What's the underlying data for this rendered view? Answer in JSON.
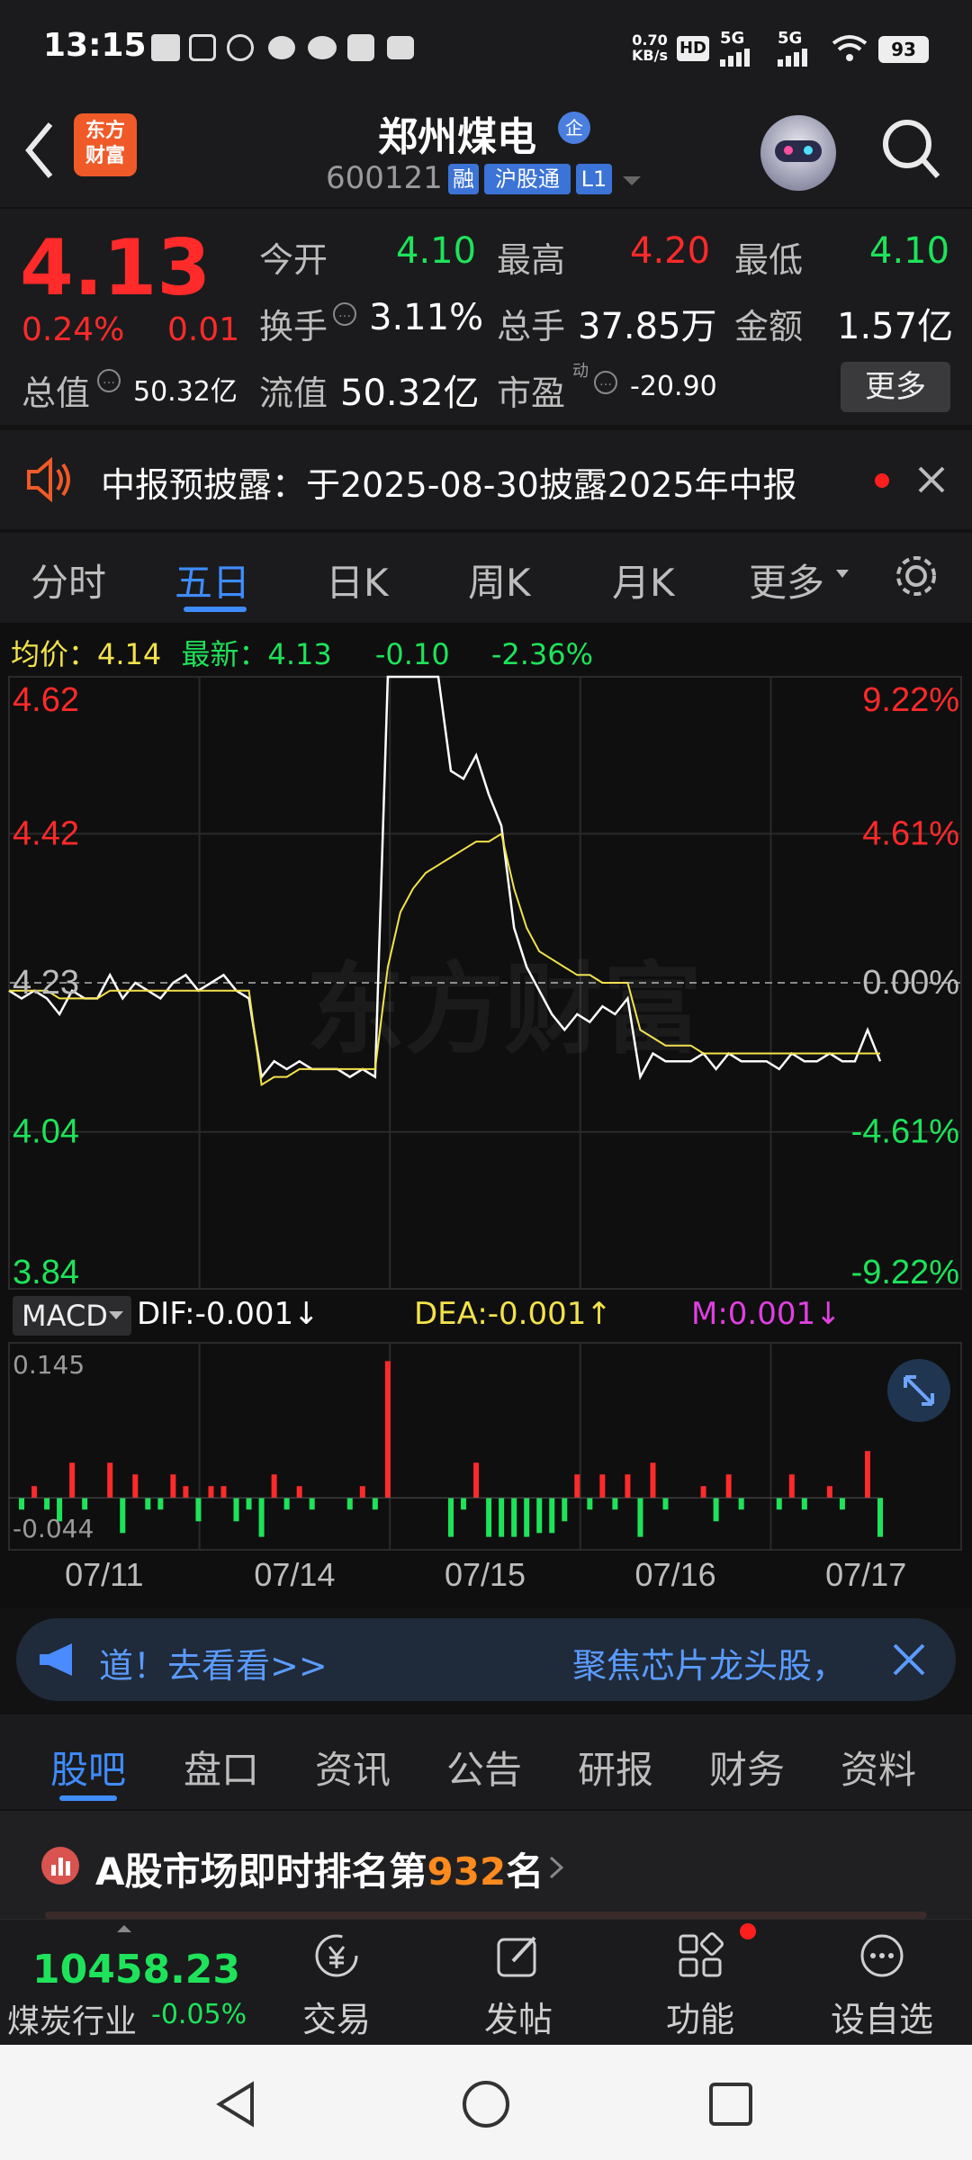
{
  "status_bar": {
    "time": "13:15",
    "net_speed_top": "0.70",
    "net_speed_bottom": "KB/s",
    "hd": "HD",
    "sig1": "5G",
    "sig2": "5G",
    "battery": "93"
  },
  "header": {
    "logo_line1": "东方",
    "logo_line2": "财富",
    "title": "郑州煤电",
    "title_badge": "企",
    "code": "600121",
    "tag_rong": "融",
    "tag_hgt": "沪股通",
    "tag_l1": "L1"
  },
  "quote": {
    "price": "4.13",
    "change_pct": "0.24%",
    "change_amt": "0.01",
    "open_label": "今开",
    "open": "4.10",
    "high_label": "最高",
    "high": "4.20",
    "low_label": "最低",
    "low": "4.10",
    "turnover_label": "换手",
    "turnover": "3.11%",
    "volume_label": "总手",
    "volume": "37.85万",
    "amount_label": "金额",
    "amount": "1.57亿",
    "mktcap_label": "总值",
    "mktcap": "50.32亿",
    "float_label": "流值",
    "float_cap": "50.32亿",
    "pe_label": "市盈",
    "pe_sup": "动",
    "pe": "-20.90",
    "more_button": "更多"
  },
  "notice": {
    "text": "中报预披露：于2025-08-30披露2025年中报"
  },
  "chart_tabs": [
    "分时",
    "五日",
    "日K",
    "周K",
    "月K",
    "更多"
  ],
  "active_chart_tab": "五日",
  "chart_header": {
    "avg_label": "均价：",
    "avg_value": "4.14",
    "latest_label": "最新：",
    "latest_value": "4.13",
    "chg": "-0.10",
    "chg_pct": "-2.36%"
  },
  "watermark": "东方财富",
  "macd": {
    "label": "MACD",
    "dif": "DIF:-0.001↓",
    "dea": "DEA:-0.001↑",
    "m": "M:0.001↓",
    "max": "0.145",
    "min": "-0.044"
  },
  "chart_data": {
    "type": "line",
    "y_left_ticks": [
      "4.62",
      "4.42",
      "4.23",
      "4.04",
      "3.84"
    ],
    "y_right_ticks": [
      "9.22%",
      "4.61%",
      "0.00%",
      "-4.61%",
      "-9.22%"
    ],
    "ylim": [
      3.84,
      4.62
    ],
    "reference": 4.23,
    "x_labels": [
      "07/11",
      "07/14",
      "07/15",
      "07/16",
      "07/17"
    ],
    "series": [
      {
        "name": "最新",
        "values": [
          4.22,
          4.21,
          4.22,
          4.21,
          4.19,
          4.22,
          4.21,
          4.21,
          4.24,
          4.21,
          4.23,
          4.22,
          4.21,
          4.23,
          4.24,
          4.22,
          4.23,
          4.24,
          4.22,
          4.21,
          4.11,
          4.13,
          4.12,
          4.13,
          4.12,
          4.12,
          4.12,
          4.11,
          4.12,
          4.11,
          4.62,
          4.62,
          4.62,
          4.62,
          4.62,
          4.5,
          4.49,
          4.52,
          4.47,
          4.43,
          4.3,
          4.25,
          4.22,
          4.19,
          4.17,
          4.19,
          4.18,
          4.2,
          4.19,
          4.21,
          4.11,
          4.14,
          4.13,
          4.13,
          4.13,
          4.14,
          4.12,
          4.14,
          4.13,
          4.13,
          4.13,
          4.12,
          4.14,
          4.13,
          4.13,
          4.14,
          4.13,
          4.13,
          4.17,
          4.13
        ]
      },
      {
        "name": "均价",
        "values": [
          4.22,
          4.22,
          4.22,
          4.22,
          4.21,
          4.21,
          4.21,
          4.21,
          4.22,
          4.22,
          4.22,
          4.22,
          4.22,
          4.22,
          4.22,
          4.22,
          4.22,
          4.22,
          4.22,
          4.22,
          4.1,
          4.11,
          4.11,
          4.12,
          4.12,
          4.12,
          4.12,
          4.12,
          4.12,
          4.12,
          4.25,
          4.32,
          4.35,
          4.37,
          4.38,
          4.39,
          4.4,
          4.41,
          4.41,
          4.42,
          4.35,
          4.3,
          4.27,
          4.26,
          4.25,
          4.24,
          4.24,
          4.23,
          4.23,
          4.23,
          4.17,
          4.16,
          4.15,
          4.15,
          4.15,
          4.14,
          4.14,
          4.14,
          4.14,
          4.14,
          4.14,
          4.14,
          4.14,
          4.14,
          4.14,
          4.14,
          4.14,
          4.14,
          4.14,
          4.14
        ]
      }
    ],
    "macd_ylim": [
      -0.044,
      0.145
    ]
  },
  "ad": {
    "text_left": "道！去看看>>",
    "text_right": "聚焦芯片龙头股，"
  },
  "forum_tabs": [
    "股吧",
    "盘口",
    "资讯",
    "公告",
    "研报",
    "财务",
    "资料"
  ],
  "active_forum_tab": "股吧",
  "rank": {
    "prefix": "A股市场即时排名第",
    "number": "932",
    "suffix": "名"
  },
  "bottom": {
    "index_value": "10458.23",
    "index_name": "煤炭行业",
    "index_chg": "-0.05%",
    "trade": "交易",
    "post": "发帖",
    "func": "功能",
    "watch": "设自选"
  }
}
